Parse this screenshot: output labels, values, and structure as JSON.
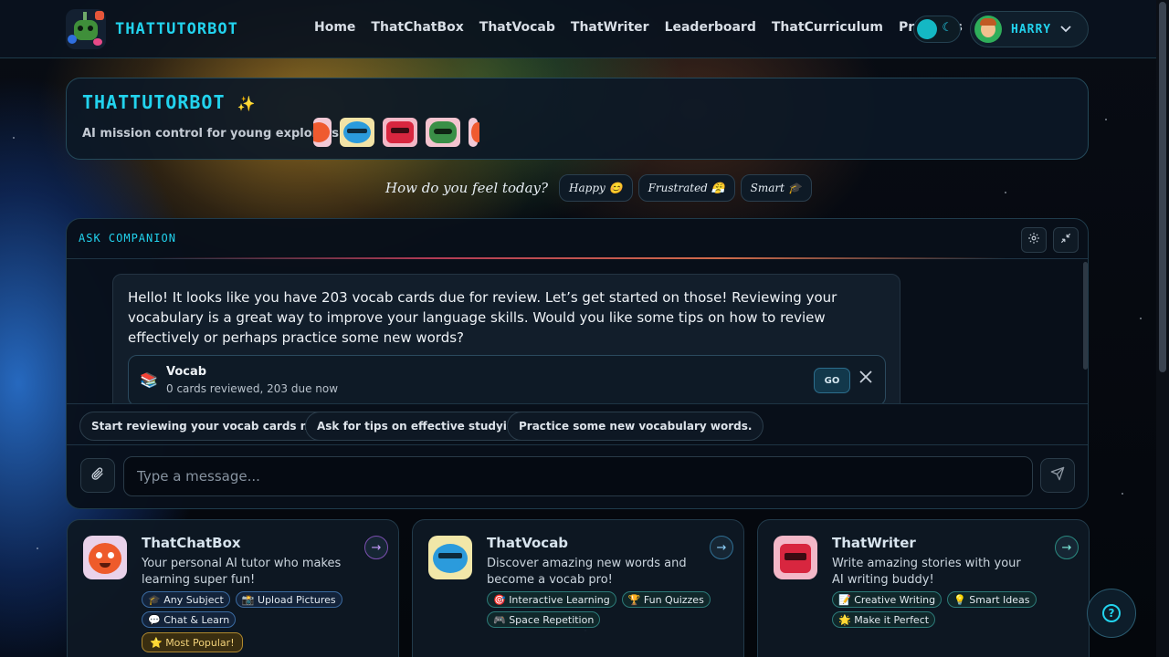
{
  "brand": {
    "name": "THATTUTORBOT"
  },
  "nav": {
    "items": [
      "Home",
      "ThatChatBox",
      "ThatVocab",
      "ThatWriter",
      "Leaderboard",
      "ThatCurriculum",
      "Progress"
    ]
  },
  "user": {
    "name": "HARRY"
  },
  "hero": {
    "title": "THATTUTORBOT",
    "sparkle": "✨",
    "subtitle": "AI mission control for young explorers"
  },
  "mood": {
    "label": "How do you feel today?",
    "options": [
      {
        "label": "Happy",
        "emoji": "😊"
      },
      {
        "label": "Frustrated",
        "emoji": "😤"
      },
      {
        "label": "Smart",
        "emoji": "🎓"
      }
    ]
  },
  "companion": {
    "title": "ASK COMPANION",
    "message": "Hello! It looks like you have 203 vocab cards due for review. Let’s get started on those! Reviewing your vocabulary is a great way to improve your language skills. Would you like some tips on how to review effectively or perhaps practice some new words?",
    "card": {
      "icon": "📚",
      "title": "Vocab",
      "subtitle": "0 cards reviewed, 203 due now",
      "action": "GO"
    },
    "suggestions": [
      "Start reviewing your vocab cards now!",
      "Ask for tips on effective studying.",
      "Practice some new vocabulary words."
    ],
    "input_placeholder": "Type a message..."
  },
  "features": [
    {
      "title": "ThatChatBox",
      "description": "Your personal AI tutor who makes learning super fun!",
      "tags": [
        "🎓 Any Subject",
        "📸 Upload Pictures",
        "💬 Chat & Learn"
      ],
      "badge": "⭐ Most Popular!",
      "accent": "#a855f7"
    },
    {
      "title": "ThatVocab",
      "description": "Discover amazing new words and become a vocab pro!",
      "tags": [
        "🎯 Interactive Learning",
        "🏆 Fun Quizzes",
        "🎮 Space Repetition"
      ],
      "accent": "#38bdf8"
    },
    {
      "title": "ThatWriter",
      "description": "Write amazing stories with your AI writing buddy!",
      "tags": [
        "📝 Creative Writing",
        "💡 Smart Ideas",
        "🌟 Make it Perfect"
      ],
      "accent": "#2dd4bf"
    }
  ],
  "colors": {
    "accent": "#22d3ee",
    "panel": "#0c1826",
    "border": "#24495a"
  }
}
